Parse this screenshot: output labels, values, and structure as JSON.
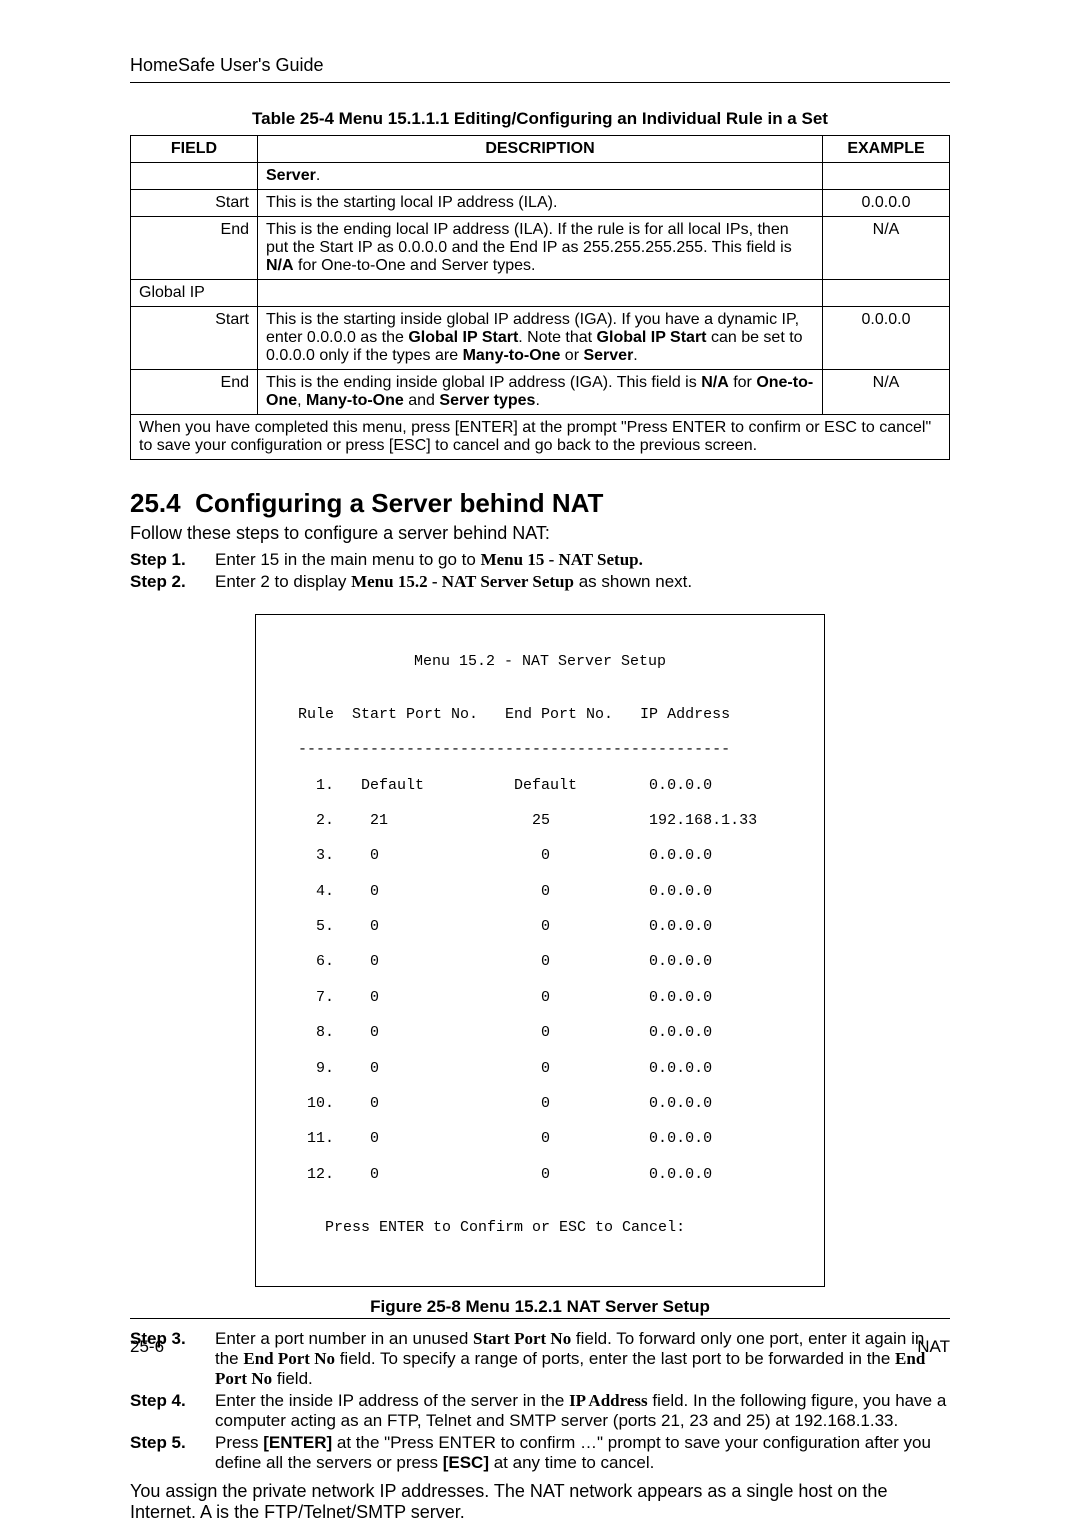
{
  "header": {
    "title": "HomeSafe User's Guide"
  },
  "table": {
    "caption": "Table 25-4 Menu 15.1.1.1 Editing/Configuring an Individual Rule in a Set",
    "headers": {
      "field": "FIELD",
      "description": "DESCRIPTION",
      "example": "EXAMPLE"
    },
    "rows": {
      "server_label": "Server",
      "start1": {
        "field": "Start",
        "desc": "This is the starting local IP address (ILA).",
        "example": "0.0.0.0"
      },
      "end1": {
        "field": "End",
        "desc_a": "This is the ending local IP address (ILA). If the rule is for all local IPs, then put the Start IP as 0.0.0.0 and the End IP as 255.255.255.255. This field is ",
        "desc_b": "N/A",
        "desc_c": " for One-to-One and Server types.",
        "example": "N/A"
      },
      "globalip": {
        "field": "Global IP"
      },
      "start2": {
        "field": "Start",
        "desc_a": "This is the starting inside global IP address (IGA). If you have a dynamic IP, enter 0.0.0.0 as the ",
        "desc_b": "Global IP Start",
        "desc_c": ". Note that ",
        "desc_d": "Global IP Start",
        "desc_e": " can be set to 0.0.0.0 only if the types are ",
        "desc_f": "Many-to-One",
        "desc_g": " or ",
        "desc_h": "Server",
        "desc_i": ".",
        "example": "0.0.0.0"
      },
      "end2": {
        "field": "End",
        "desc_a": "This is the ending inside global IP address (IGA). This field is ",
        "desc_b": "N/A",
        "desc_c": " for ",
        "desc_d": "One-to-One",
        "desc_e": ", ",
        "desc_f": "Many-to-One",
        "desc_g": " and ",
        "desc_h": "Server types",
        "desc_i": ".",
        "example": "N/A"
      },
      "footer": "When you have completed this menu, press [ENTER] at the prompt \"Press ENTER to confirm or ESC to cancel\" to save your configuration or press [ESC] to cancel and go back to the previous screen."
    }
  },
  "section": {
    "number": "25.4",
    "title": "Configuring a Server behind NAT",
    "intro": "Follow these steps to configure a server behind NAT:"
  },
  "steps": {
    "s1": {
      "label": "Step 1.",
      "a": "Enter 15 in the main menu to go to ",
      "b": "Menu 15 - NAT Setup."
    },
    "s2": {
      "label": "Step 2.",
      "a": "Enter 2 to display ",
      "b": "Menu 15.2 - NAT Server Setup",
      "c": " as shown next."
    },
    "s3": {
      "label": "Step 3.",
      "a": "Enter a port number in an unused ",
      "b": "Start Port No",
      "c": " field. To forward only one port, enter it again in the ",
      "d": "End Port No",
      "e": " field. To specify a range of ports, enter the last port to be forwarded in the ",
      "f": "End Port No",
      "g": " field."
    },
    "s4": {
      "label": "Step 4.",
      "a": "Enter the inside IP address of the server in the ",
      "b": "IP Address",
      "c": " field. In the following figure, you have a computer acting as an FTP, Telnet and SMTP server (ports 21, 23 and 25) at 192.168.1.33."
    },
    "s5": {
      "label": "Step 5.",
      "a": "Press ",
      "b": "[ENTER]",
      "c": " at the \"Press ENTER to confirm …\" prompt to save your configuration after you define all the servers or press ",
      "d": "[ESC]",
      "e": " at any time to cancel."
    }
  },
  "screen": {
    "title": "Menu 15.2 - NAT Server Setup",
    "header": "  Rule  Start Port No.   End Port No.   IP Address",
    "rule": "  ------------------------------------------------",
    "rows": [
      "    1.   Default          Default        0.0.0.0",
      "    2.    21                25           192.168.1.33",
      "    3.    0                  0           0.0.0.0",
      "    4.    0                  0           0.0.0.0",
      "    5.    0                  0           0.0.0.0",
      "    6.    0                  0           0.0.0.0",
      "    7.    0                  0           0.0.0.0",
      "    8.    0                  0           0.0.0.0",
      "    9.    0                  0           0.0.0.0",
      "   10.    0                  0           0.0.0.0",
      "   11.    0                  0           0.0.0.0",
      "   12.    0                  0           0.0.0.0"
    ],
    "footer": "     Press ENTER to Confirm or ESC to Cancel:"
  },
  "figure_caption": "Figure 25-8 Menu 15.2.1 NAT Server Setup",
  "closing": "You assign the private network IP addresses. The NAT network appears as a single host on the Internet. A is the FTP/Telnet/SMTP server.",
  "page_footer": {
    "left": "25-6",
    "right": "NAT"
  }
}
